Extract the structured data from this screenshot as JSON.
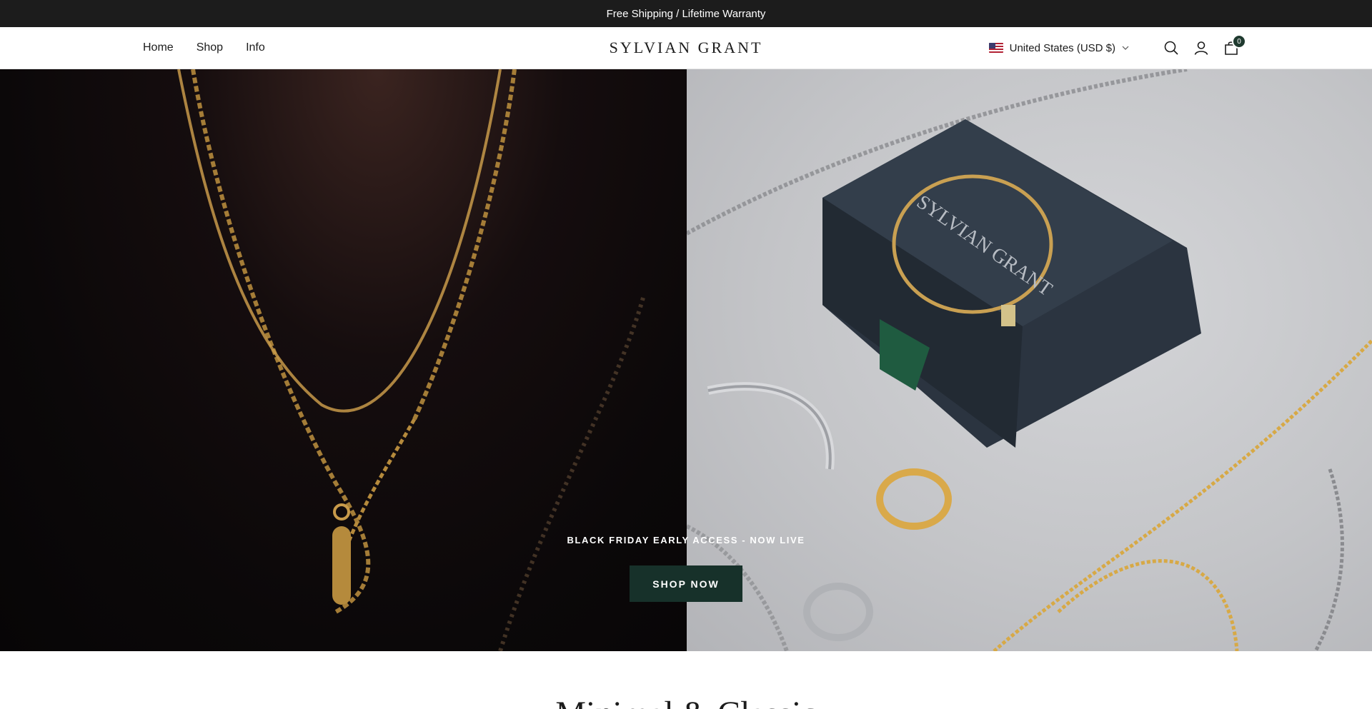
{
  "announcement": {
    "text": "Free Shipping / Lifetime Warranty"
  },
  "header": {
    "nav": [
      {
        "label": "Home"
      },
      {
        "label": "Shop"
      },
      {
        "label": "Info"
      }
    ],
    "logo": "SYLVIAN GRANT",
    "country": {
      "label": "United States (USD $)",
      "flag_icon": "us-flag-icon"
    },
    "cart_count": "0",
    "icons": [
      "search-icon",
      "account-icon",
      "cart-icon",
      "chevron-down-icon"
    ]
  },
  "hero": {
    "subheading": "BLACK FRIDAY EARLY ACCESS - NOW LIVE",
    "button_label": "SHOP NOW",
    "box_logo": "SYLVIAN GRANT"
  },
  "section": {
    "heading": "Minimal & Classic"
  },
  "colors": {
    "announce_bg": "#1c1c1c",
    "button_bg": "#17312a",
    "cart_badge": "#1f3a2f"
  }
}
